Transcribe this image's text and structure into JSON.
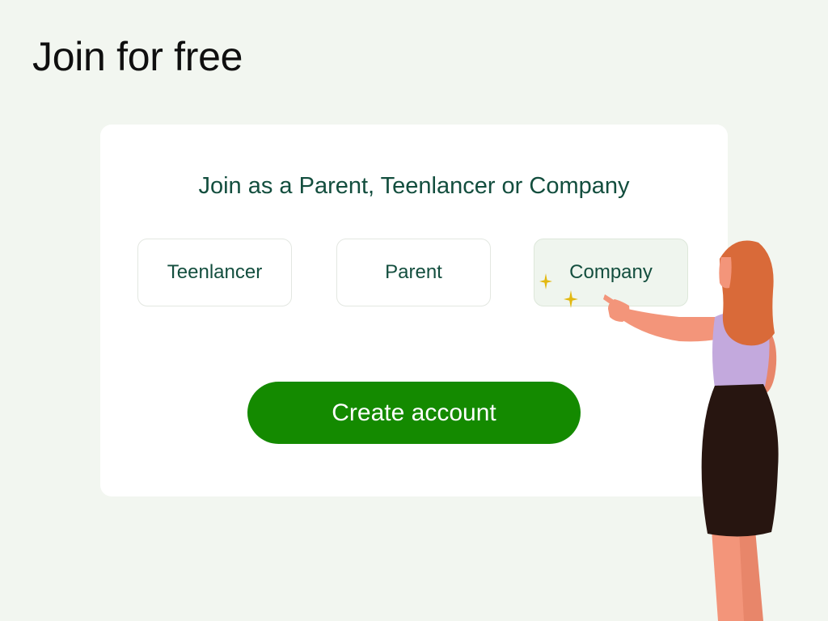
{
  "page": {
    "title": "Join for free"
  },
  "signup": {
    "heading": "Join as a Parent, Teenlancer or Company",
    "options": [
      {
        "label": "Teenlancer",
        "selected": false
      },
      {
        "label": "Parent",
        "selected": false
      },
      {
        "label": "Company",
        "selected": true
      }
    ],
    "submit_label": "Create account"
  },
  "colors": {
    "background": "#f2f6f0",
    "card": "#ffffff",
    "heading_text": "#134e3e",
    "selected_option_bg": "#eff5ee",
    "button_bg": "#148a00",
    "button_text": "#ffffff",
    "sparkle": "#e2b810"
  },
  "icons": {
    "sparkle": "sparkle-icon",
    "illustration": "woman-pointing-illustration"
  }
}
